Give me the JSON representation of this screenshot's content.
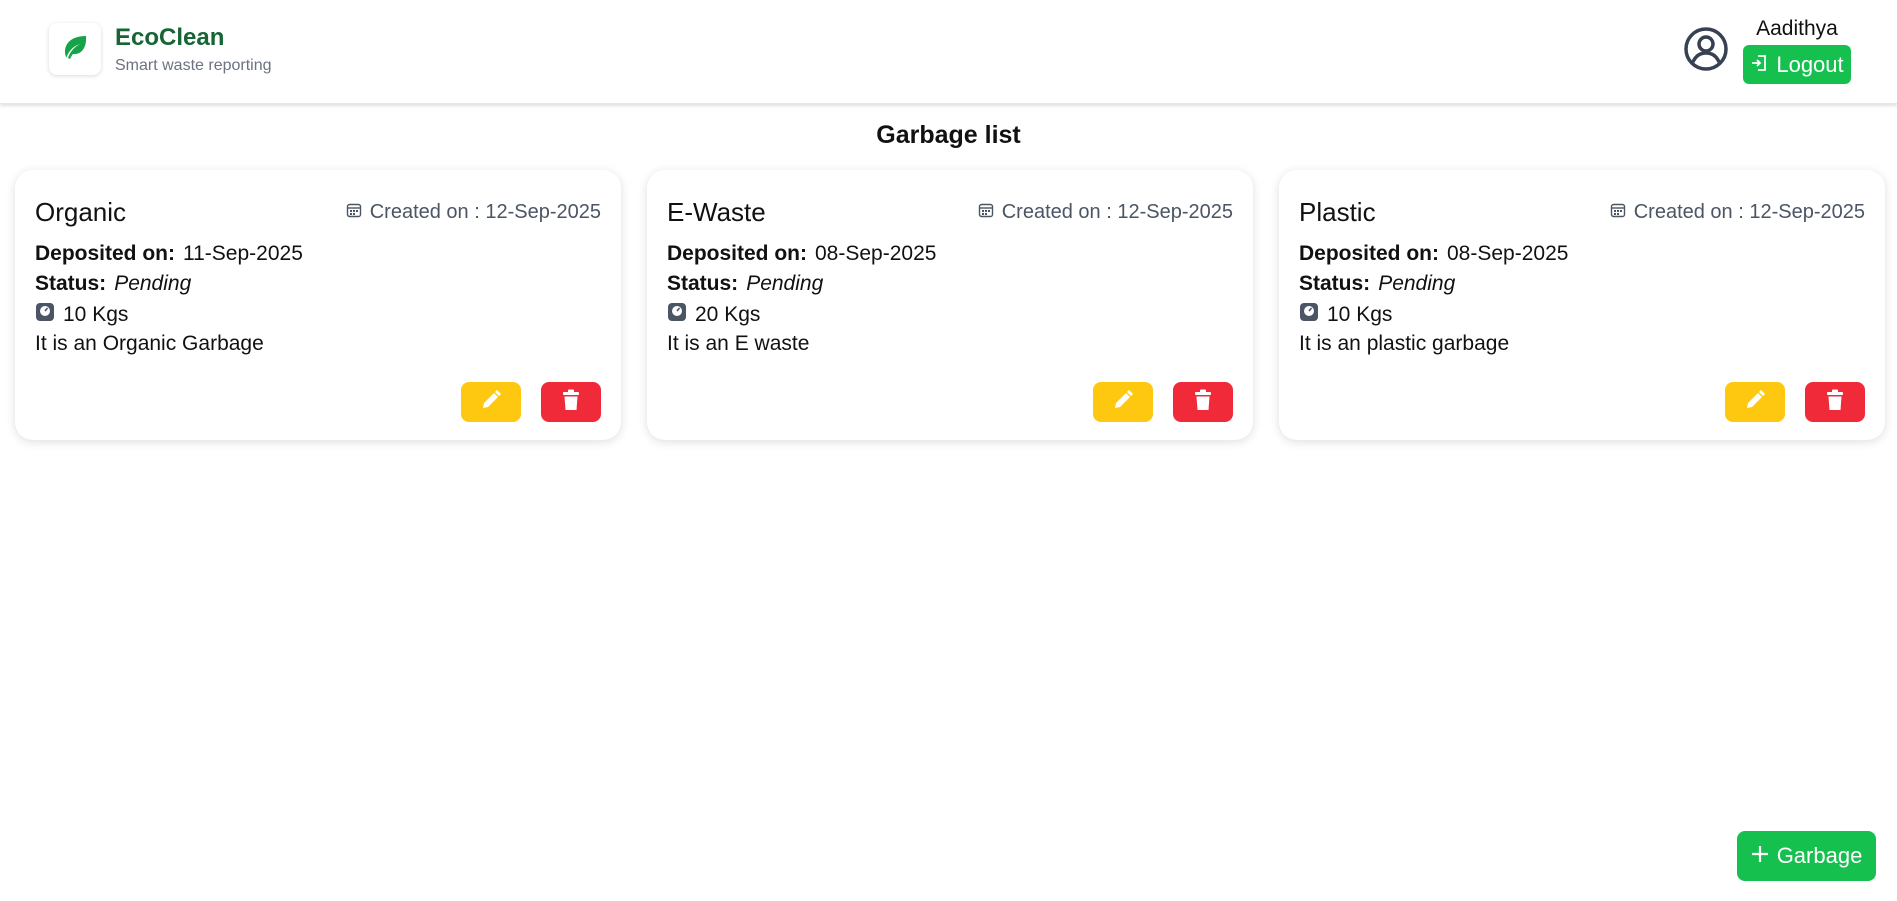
{
  "brand": {
    "name": "EcoClean",
    "tagline": "Smart waste reporting",
    "icon": "leaf-icon",
    "color": "#166534"
  },
  "user": {
    "name": "Aadithya",
    "logout_label": "Logout",
    "icon": "user-circle-icon"
  },
  "page": {
    "title": "Garbage list"
  },
  "cards": [
    {
      "title": "Organic",
      "created": "Created on : 12-Sep-2025",
      "deposited_label": "Deposited on:",
      "deposited": "11-Sep-2025",
      "status_label": "Status:",
      "status": "Pending",
      "weight": "10 Kgs",
      "description": "It is an Organic Garbage"
    },
    {
      "title": "E-Waste",
      "created": "Created on : 12-Sep-2025",
      "deposited_label": "Deposited on:",
      "deposited": "08-Sep-2025",
      "status_label": "Status:",
      "status": "Pending",
      "weight": "20 Kgs",
      "description": "It is an E waste"
    },
    {
      "title": "Plastic",
      "created": "Created on : 12-Sep-2025",
      "deposited_label": "Deposited on:",
      "deposited": "08-Sep-2025",
      "status_label": "Status:",
      "status": "Pending",
      "weight": "10 Kgs",
      "description": "It is an plastic garbage"
    }
  ],
  "actions": {
    "add_label": "Garbage"
  },
  "colors": {
    "accent": "#16c04f",
    "edit": "#fec810",
    "delete": "#f02a38"
  }
}
